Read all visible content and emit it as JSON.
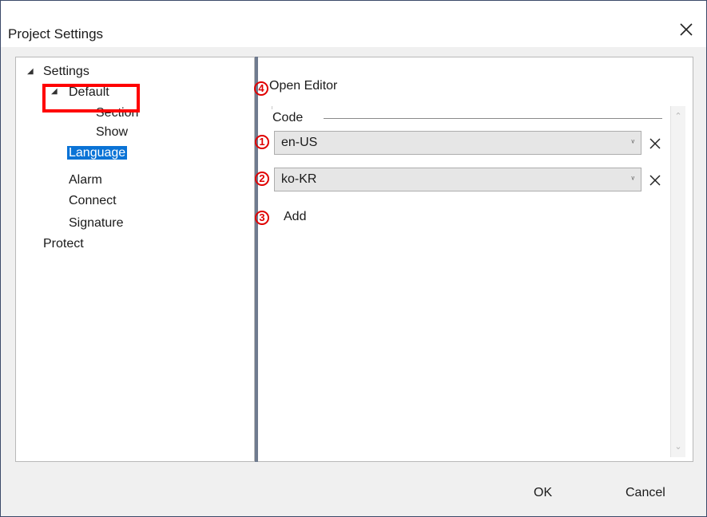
{
  "window": {
    "title": "Project Settings"
  },
  "tree": {
    "items": [
      {
        "label": "Settings",
        "expanded": true
      },
      {
        "label": "Default",
        "expanded": true
      },
      {
        "label": "Section"
      },
      {
        "label": "Show"
      },
      {
        "label": "Language",
        "selected": true
      },
      {
        "label": "Alarm"
      },
      {
        "label": "Connect"
      },
      {
        "label": "Signature"
      },
      {
        "label": "Protect"
      }
    ]
  },
  "language": {
    "open_editor_label": "Open Editor",
    "group_label": "Code",
    "codes": [
      {
        "value": "en-US"
      },
      {
        "value": "ko-KR"
      }
    ],
    "add_label": "Add"
  },
  "annotations": {
    "badge1": "1",
    "badge2": "2",
    "badge3": "3",
    "badge4": "4"
  },
  "footer": {
    "ok_label": "OK",
    "cancel_label": "Cancel"
  },
  "colors": {
    "selection": "#0a73d6",
    "highlight": "#ff0000",
    "splitter": "#6f7b8f"
  },
  "icons": {
    "close": "close-icon",
    "expand": "triangle-down-icon",
    "dropdown": "chevron-down-icon",
    "remove": "close-icon"
  }
}
